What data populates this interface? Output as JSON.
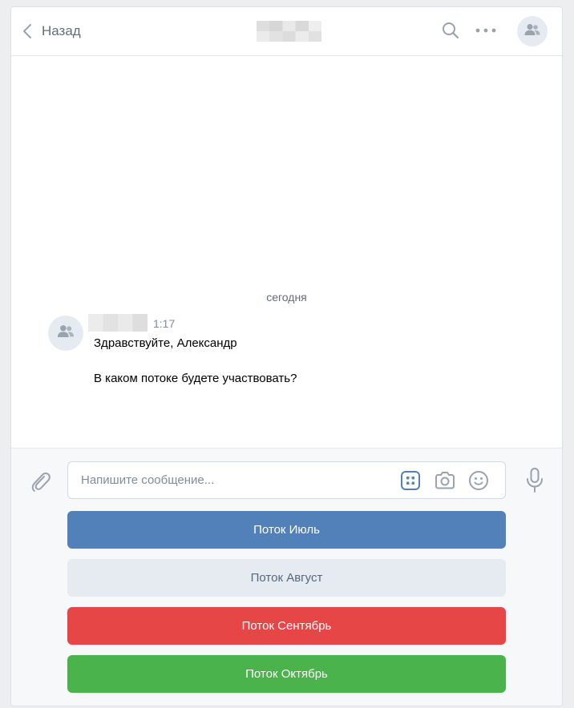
{
  "header": {
    "back_label": "Назад",
    "icons": [
      "chevron-left-icon",
      "search-icon",
      "more-icon",
      "group-avatar-icon"
    ]
  },
  "history": {
    "date_separator": "сегодня",
    "message": {
      "time": "1:17",
      "lines": [
        "Здравствуйте, Александр",
        "",
        "В каком потоке будете участвовать?"
      ]
    }
  },
  "composer": {
    "placeholder": "Напишите сообщение...",
    "icons": [
      "paperclip-icon",
      "keyboard-icon",
      "camera-icon",
      "emoji-icon",
      "microphone-icon"
    ]
  },
  "keyboard": {
    "buttons": [
      {
        "label": "Поток Июль",
        "color": "#5181b8"
      },
      {
        "label": "Поток Август",
        "color": "#e5ebf1"
      },
      {
        "label": "Поток Сентябрь",
        "color": "#e64646"
      },
      {
        "label": "Поток Октябрь",
        "color": "#4bb34b"
      }
    ]
  }
}
